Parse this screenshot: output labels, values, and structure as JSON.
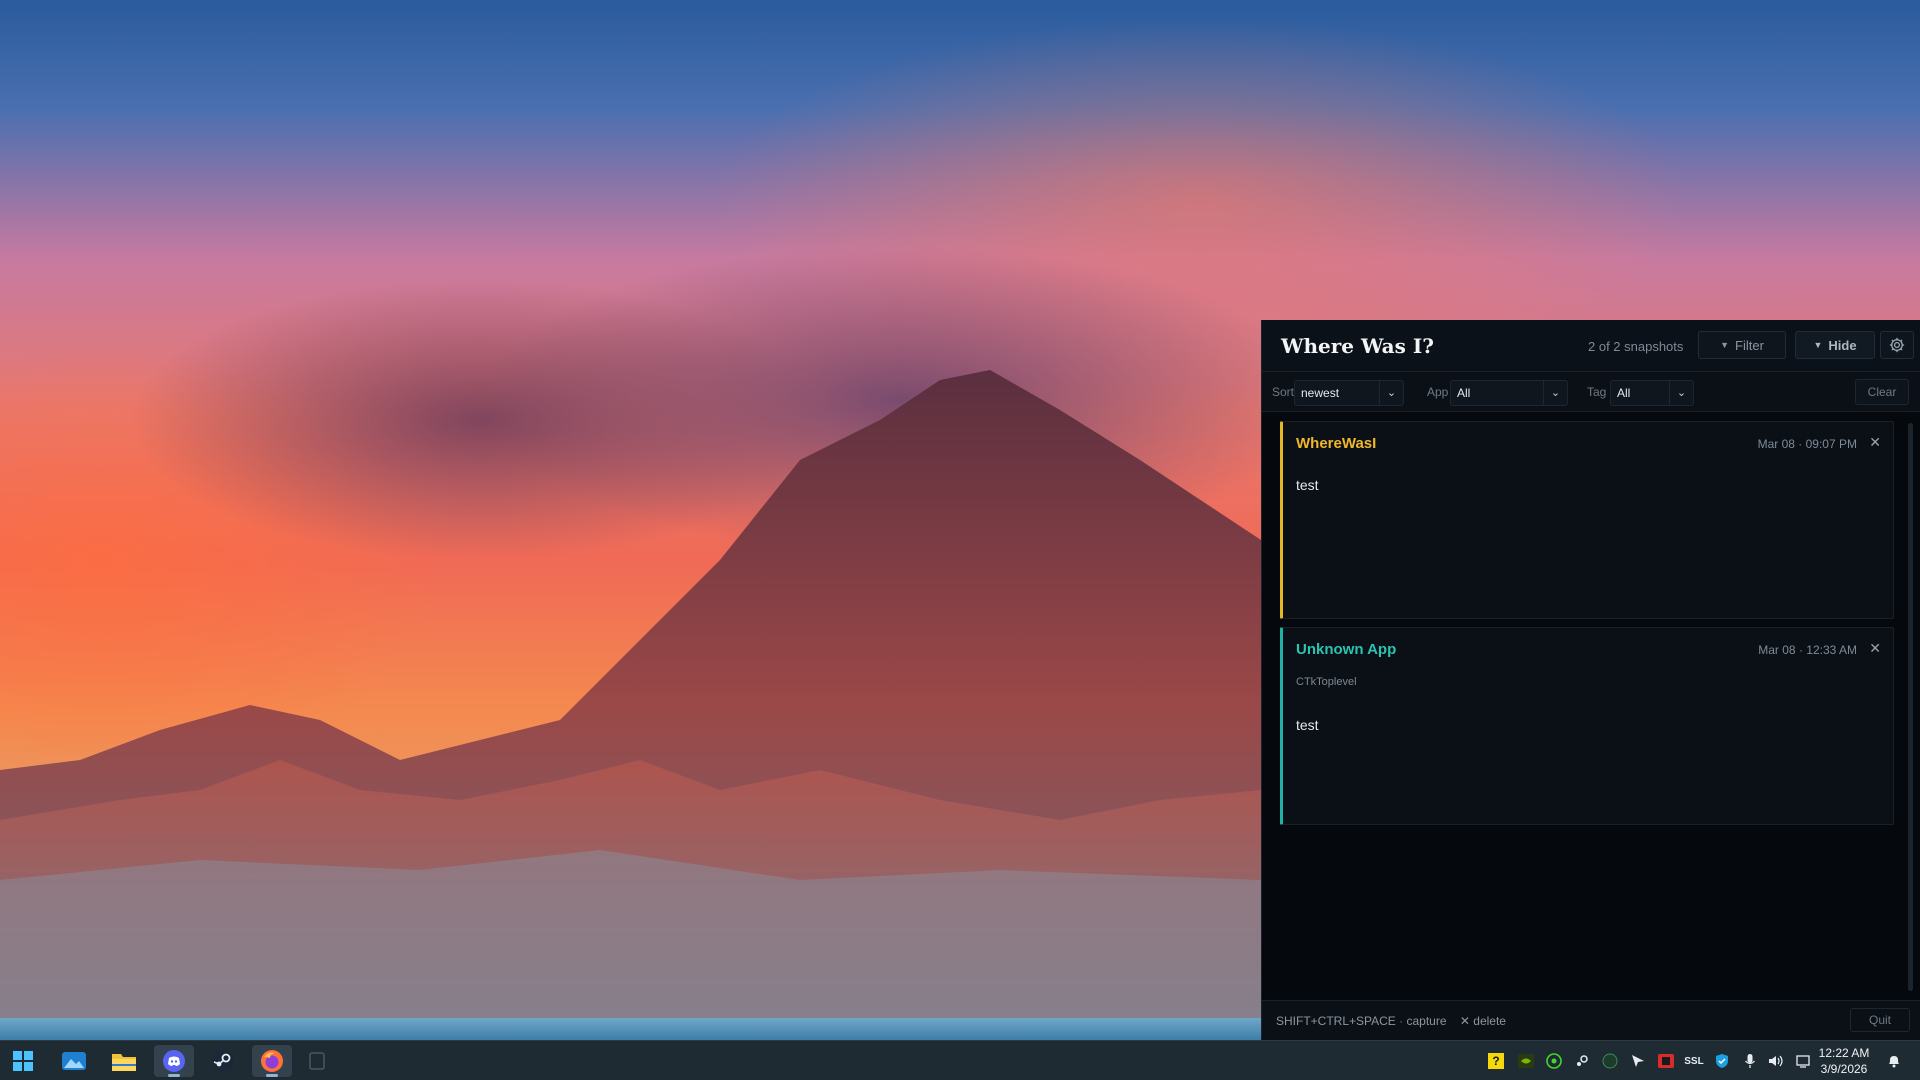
{
  "app": {
    "title": "Where Was I?",
    "snapshot_count": "2 of 2 snapshots",
    "filter_label": "Filter",
    "hide_label": "Hide",
    "gear_icon": "gear-icon"
  },
  "filters": {
    "sort_label": "Sort",
    "sort_value": "newest",
    "app_label": "App",
    "app_value": "All",
    "tag_label": "Tag",
    "tag_value": "All",
    "clear_label": "Clear"
  },
  "snapshots": [
    {
      "app": "WhereWasI",
      "date": "Mar 08",
      "time": "09:07 PM",
      "sep": "·",
      "subtitle": "",
      "note": "test",
      "accent": "#e6b821"
    },
    {
      "app": "Unknown App",
      "date": "Mar 08",
      "time": "12:33 AM",
      "sep": "·",
      "subtitle": "CTkToplevel",
      "note": "test",
      "accent": "#1fb3a6"
    }
  ],
  "footer": {
    "shortcut": "SHIFT+CTRL+SPACE",
    "sep": "·",
    "capture": "capture",
    "delete_symbol": "✕",
    "delete": "delete",
    "quit_label": "Quit"
  },
  "taskbar": {
    "time": "12:22 AM",
    "date": "3/9/2026",
    "tray_ssl": "SSL",
    "apps": [
      "start-icon",
      "photos-icon",
      "file-explorer-icon",
      "discord-icon",
      "steam-icon",
      "firefox-icon",
      "window-icon"
    ]
  }
}
